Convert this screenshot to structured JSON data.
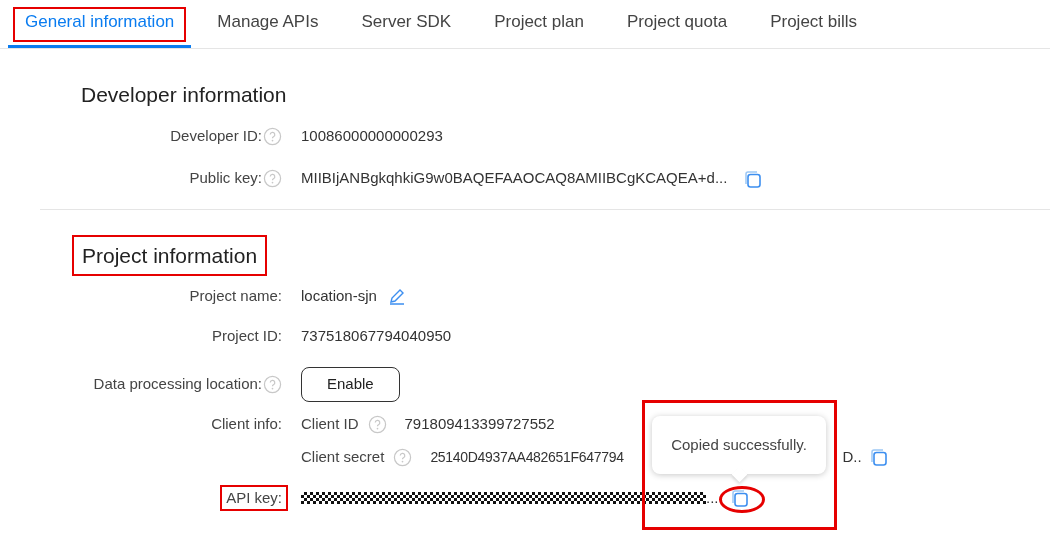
{
  "tabs": [
    {
      "label": "General information",
      "selected": true
    },
    {
      "label": "Manage APIs",
      "selected": false
    },
    {
      "label": "Server SDK",
      "selected": false
    },
    {
      "label": "Project plan",
      "selected": false
    },
    {
      "label": "Project quota",
      "selected": false
    },
    {
      "label": "Project bills",
      "selected": false
    }
  ],
  "developer": {
    "heading": "Developer information",
    "fields": [
      {
        "label": "Developer ID:",
        "value": "10086000000000293",
        "copy": false
      },
      {
        "label": "Public key:",
        "value": "MIIBIjANBgkqhkiG9w0BAQEFAAOCAQ8AMIIBCgKCAQEA+d...",
        "copy": true
      }
    ]
  },
  "project": {
    "heading": "Project information",
    "name_label": "Project name:",
    "name": "location-sjn",
    "id_label": "Project ID:",
    "id": "737518067794040950",
    "location_label": "Data processing location:",
    "location_button": "Enable",
    "client_label": "Client info:",
    "client_id_label": "Client ID",
    "client_id": "791809413399727552",
    "client_secret_label": "Client secret",
    "client_secret_start": "25140D4937AA482651F647794",
    "client_secret_end": "D..",
    "api_key_label": "API key:",
    "api_key_tail": "..."
  },
  "tooltip": "Copied successfully."
}
